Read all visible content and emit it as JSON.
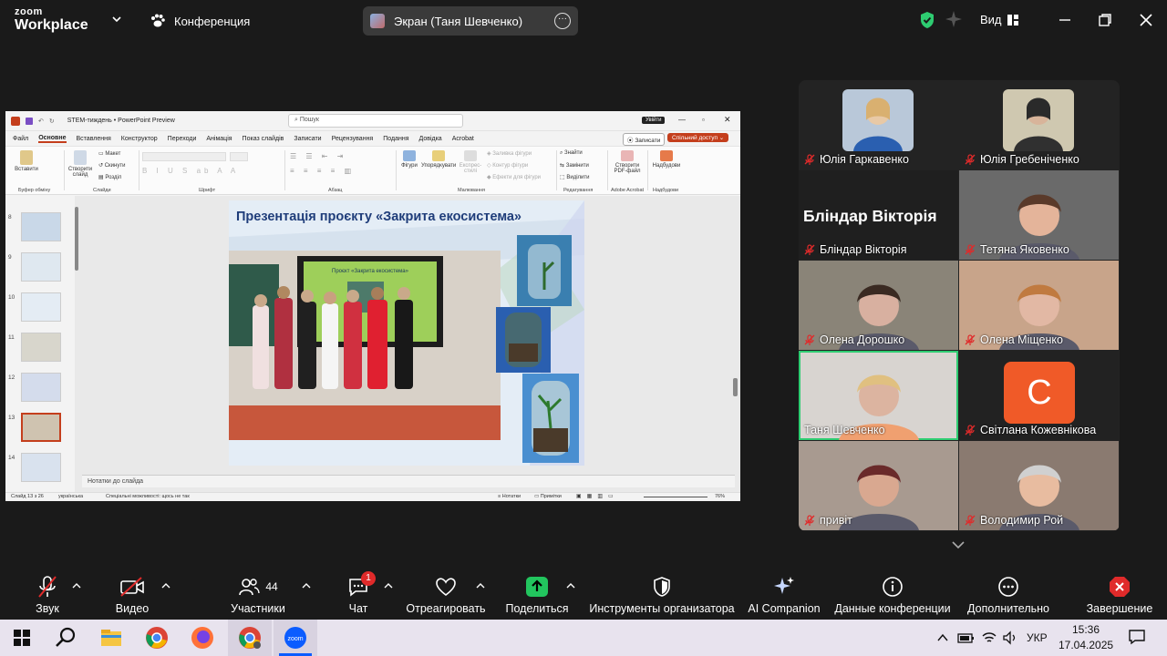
{
  "app": {
    "logo_line1": "zoom",
    "logo_line2": "Workplace",
    "conference_label": "Конференция",
    "screen_share_label": "Экран (Таня Шевченко)",
    "view_label": "Вид"
  },
  "presentation": {
    "file_title": "STEM-тиждень  •  PowerPoint Preview",
    "search_placeholder": "Пошук",
    "login_label": "Увійти",
    "menu": [
      "Файл",
      "Основне",
      "Вставлення",
      "Конструктор",
      "Переходи",
      "Анімація",
      "Показ слайдів",
      "Записати",
      "Рецензування",
      "Подання",
      "Довідка",
      "Acrobat"
    ],
    "record_button": "Записати",
    "share_button": "Спільний доступ",
    "ribbon": {
      "paste": "Вставити",
      "new_slide": "Створити слайд",
      "layout": "Макет",
      "reset": "Скинути",
      "sections": "Розділ",
      "shapes": "Фігури",
      "arrange": "Упорядкувати",
      "quick_styles": "Експрес-стилі",
      "shape_fill": "Заливка фігури",
      "shape_outline": "Контур фігури",
      "shape_effects": "Ефекти для фігури",
      "find": "Знайти",
      "replace": "Замінити",
      "select": "Виділити",
      "create_pdf": "Створити PDF-файл",
      "addins": "Надбудови",
      "groups": [
        "Буфер обміну",
        "Слайди",
        "Шрифт",
        "Абзац",
        "Малювання",
        "Редагування",
        "Adobe Acrobat",
        "Надбудови"
      ]
    },
    "thumbnail_numbers": [
      "8",
      "9",
      "10",
      "11",
      "12",
      "13",
      "14"
    ],
    "slide_title": "Презентація проєкту «Закрита екосистема»",
    "slide_board_text": "Проєкт «Закрита екосистема»",
    "notes_label": "Нотатки до слайда",
    "status": {
      "slide_counter": "Слайд 13 з 26",
      "language": "українська",
      "accessibility": "Спеціальні можливості: щось не так",
      "notes": "Нотатки",
      "comments": "Примітки",
      "zoom": "76%"
    }
  },
  "participants": [
    {
      "name": "Юлія Гаркавенко",
      "muted": true,
      "tile": "photo-thumb"
    },
    {
      "name": "Юлія Гребеніченко",
      "muted": true,
      "tile": "photo-thumb"
    },
    {
      "name": "Блiндар Вікторія",
      "muted": true,
      "tile": "name-only",
      "big_name": "Блiндар Вікторія"
    },
    {
      "name": "Тетяна Яковенко",
      "muted": true,
      "tile": "video"
    },
    {
      "name": "Олена Дорошко",
      "muted": true,
      "tile": "video"
    },
    {
      "name": "Олена Міщенко",
      "muted": true,
      "tile": "video"
    },
    {
      "name": "Таня Шевченко",
      "muted": false,
      "tile": "video",
      "active_speaker": true
    },
    {
      "name": "Світлана Кожевнікова",
      "muted": true,
      "tile": "avatar",
      "avatar_letter": "C",
      "avatar_color": "#f05a28"
    },
    {
      "name": "привіт",
      "muted": true,
      "tile": "video"
    },
    {
      "name": "Володимир Рой",
      "muted": true,
      "tile": "video"
    }
  ],
  "toolbar": {
    "audio": "Звук",
    "video": "Видео",
    "participants": "Участники",
    "participants_count": "44",
    "chat": "Чат",
    "chat_badge": "1",
    "react": "Отреагировать",
    "share": "Поделиться",
    "host_tools": "Инструменты организатора",
    "ai_companion": "AI Companion",
    "meeting_info": "Данные конференции",
    "more": "Дополнительно",
    "end": "Завершение"
  },
  "taskbar": {
    "language": "УКР",
    "time": "15:36",
    "date": "17.04.2025"
  },
  "colors": {
    "zoom_green": "#2ecc71",
    "share_green": "#22c55e",
    "end_red": "#e02a2a",
    "pp_accent": "#c43e1c"
  }
}
